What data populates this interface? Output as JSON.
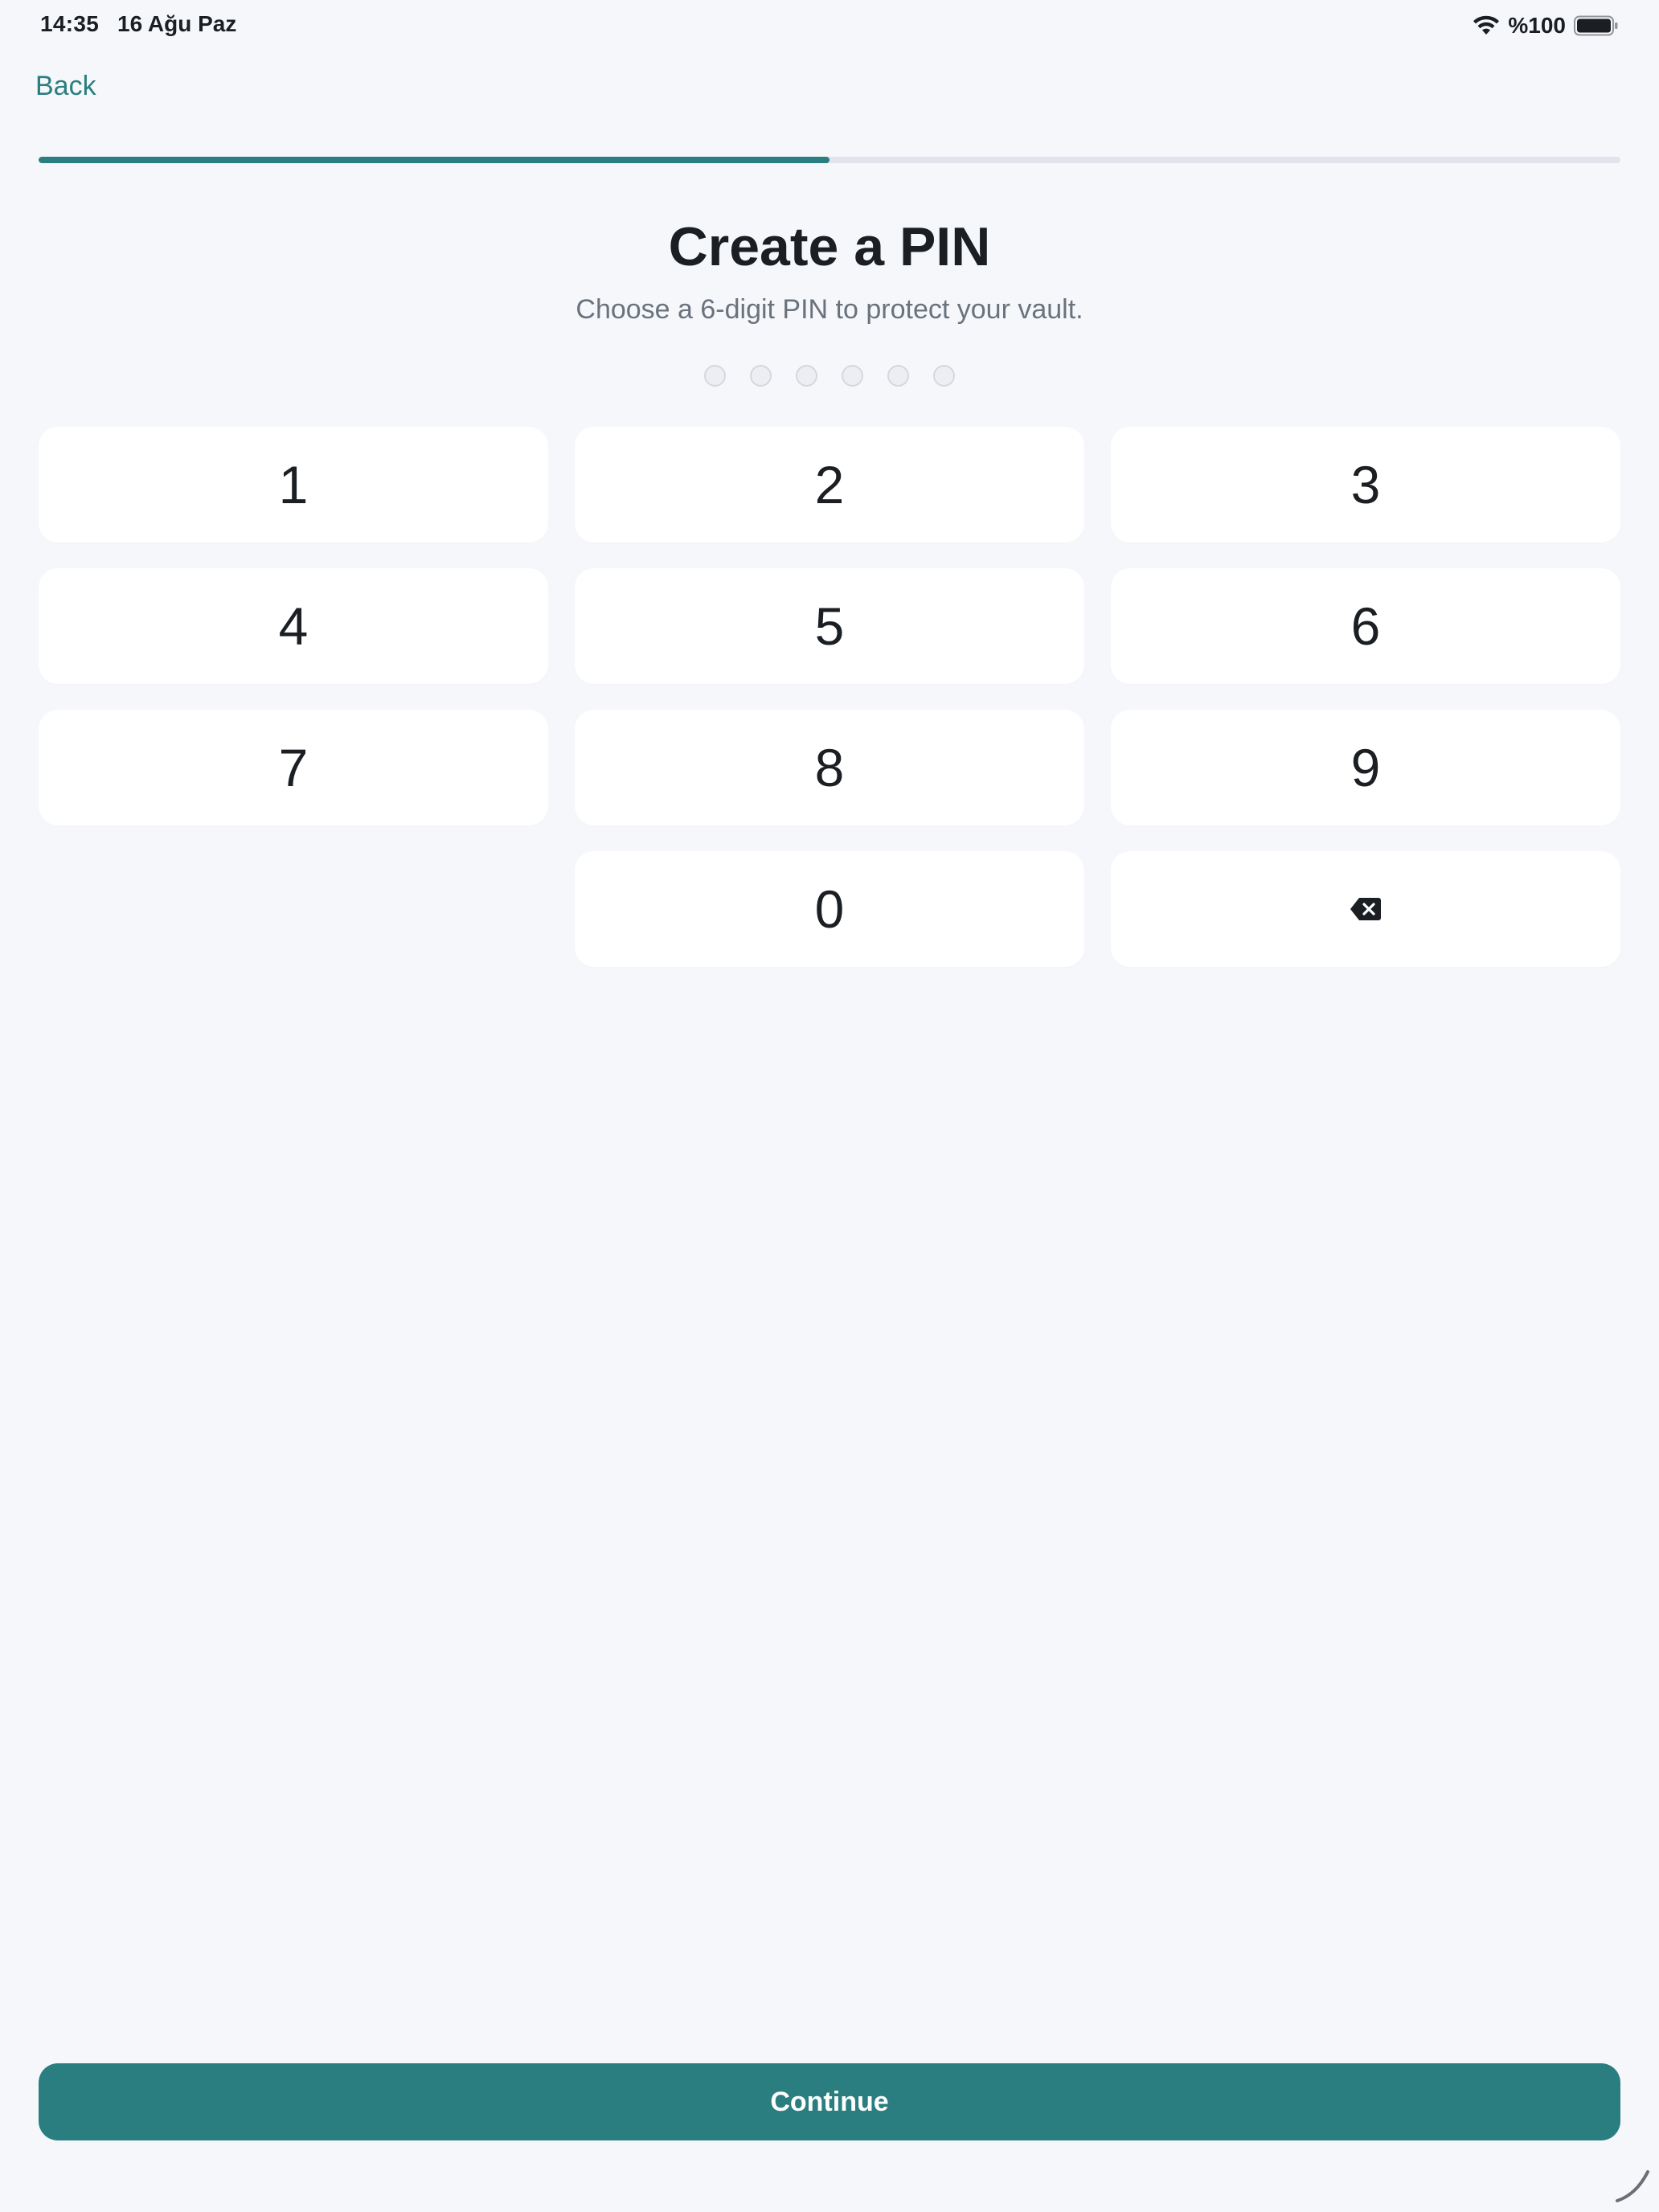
{
  "status_bar": {
    "time": "14:35",
    "date": "16 Ağu Paz",
    "battery_percent": "%100",
    "wifi_icon": "wifi-icon",
    "battery_icon": "battery-full-icon"
  },
  "nav": {
    "back_label": "Back"
  },
  "progress": {
    "fraction": 0.5
  },
  "header": {
    "title": "Create a PIN",
    "subtitle": "Choose a 6-digit PIN to protect your vault."
  },
  "pin": {
    "length": 6,
    "filled": 0
  },
  "keypad": {
    "keys": [
      "1",
      "2",
      "3",
      "4",
      "5",
      "6",
      "7",
      "8",
      "9",
      "0"
    ],
    "backspace_icon": "backspace-icon"
  },
  "footer": {
    "continue_label": "Continue"
  },
  "colors": {
    "accent": "#2a7e80",
    "background": "#f5f7fb",
    "key_background": "#ffffff",
    "dot_empty": "#eceef2"
  }
}
